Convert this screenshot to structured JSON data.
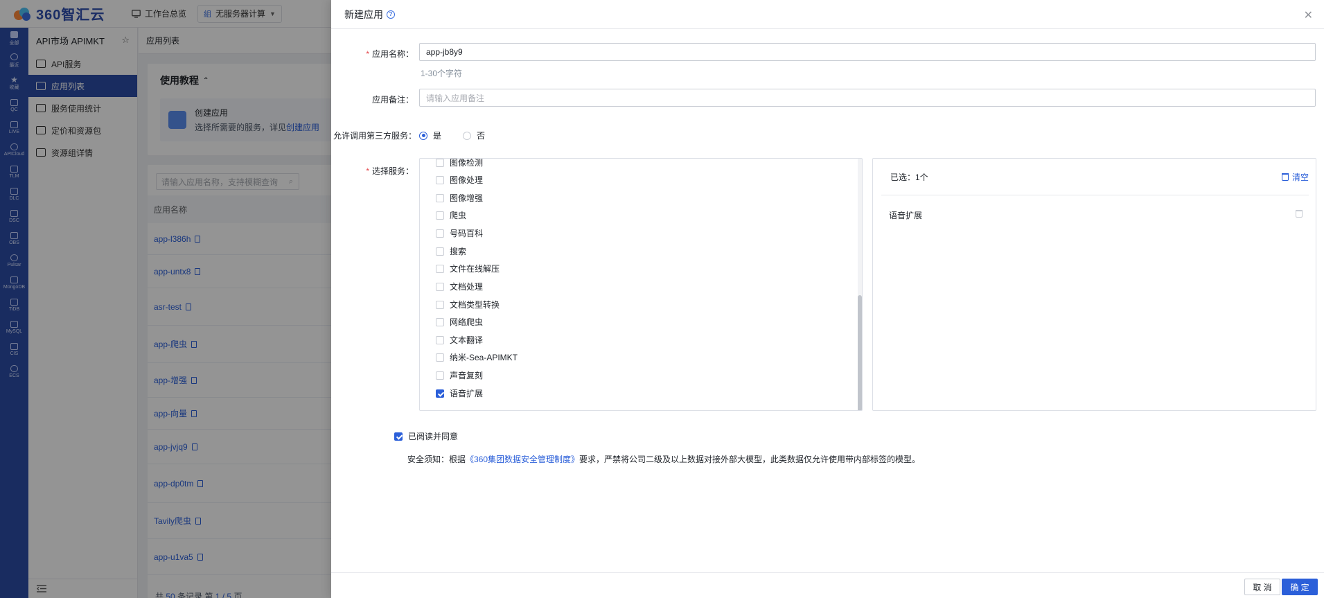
{
  "header": {
    "logo_text": "360智汇云",
    "workbench": "工作台总览",
    "project_select": "无服务器计算"
  },
  "rail": {
    "items": [
      {
        "label": "全部"
      },
      {
        "label": "最近"
      },
      {
        "label": "收藏"
      },
      {
        "label": "QC"
      },
      {
        "label": "LIVE"
      },
      {
        "label": "APICloud"
      },
      {
        "label": "TLM"
      },
      {
        "label": "DLC"
      },
      {
        "label": "DSC"
      },
      {
        "label": "OBS"
      },
      {
        "label": "Pulsar"
      },
      {
        "label": "MongoDB"
      },
      {
        "label": "TiDB"
      },
      {
        "label": "MySQL"
      },
      {
        "label": "CIS"
      },
      {
        "label": "ECS"
      }
    ]
  },
  "sidebar": {
    "title": "API市场 APIMKT",
    "items": [
      {
        "label": "API服务"
      },
      {
        "label": "应用列表"
      },
      {
        "label": "服务使用统计"
      },
      {
        "label": "定价和资源包"
      },
      {
        "label": "资源组详情"
      }
    ]
  },
  "main": {
    "breadcrumb": "应用列表",
    "tutorial_title": "使用教程",
    "tutorial_card_title": "创建应用",
    "tutorial_card_desc": "选择所需要的服务，详见",
    "tutorial_card_link": "创建应用",
    "search_placeholder": "请输入应用名称，支持模糊查询",
    "column_app_name": "应用名称",
    "rows": [
      "app-l386h",
      "app-untx8",
      "asr-test",
      "app-爬虫",
      "app-增强",
      "app-向量",
      "app-jvjq9",
      "app-dp0tm",
      "Tavily爬虫",
      "app-u1va5"
    ],
    "footer_prefix": "共",
    "footer_total": "50",
    "footer_mid": "条记录 第",
    "footer_page": "1 / 5",
    "footer_suffix": "页"
  },
  "drawer": {
    "title": "新建应用",
    "app_name_label": "应用名称：",
    "app_name_value": "app-jb8y9",
    "app_name_hint": "1-30个字符",
    "remark_label": "应用备注：",
    "remark_placeholder": "请输入应用备注",
    "third_party_label": "允许调用第三方服务：",
    "radio_yes": "是",
    "radio_no": "否",
    "service_label": "选择服务：",
    "services": [
      {
        "label": "图像检测",
        "checked": false
      },
      {
        "label": "图像处理",
        "checked": false
      },
      {
        "label": "图像增强",
        "checked": false
      },
      {
        "label": "爬虫",
        "checked": false
      },
      {
        "label": "号码百科",
        "checked": false
      },
      {
        "label": "搜索",
        "checked": false
      },
      {
        "label": "文件在线解压",
        "checked": false
      },
      {
        "label": "文档处理",
        "checked": false
      },
      {
        "label": "文档类型转换",
        "checked": false
      },
      {
        "label": "网络爬虫",
        "checked": false
      },
      {
        "label": "文本翻译",
        "checked": false
      },
      {
        "label": "纳米-Sea-APIMKT",
        "checked": false
      },
      {
        "label": "声音复刻",
        "checked": false
      },
      {
        "label": "语音扩展",
        "checked": true
      }
    ],
    "selected_count": "已选：1个",
    "clear_label": "清空",
    "selected_items": [
      "语音扩展"
    ],
    "agree_label": "已阅读并同意",
    "notice_prefix": "安全须知：根据",
    "notice_link": "《360集团数据安全管理制度》",
    "notice_suffix": "要求，严禁将公司二级及以上数据对接外部大模型，此类数据仅允许使用带内部标签的模型。",
    "cancel_label": "取 消",
    "ok_label": "确 定"
  },
  "colors": {
    "primary": "#2b5fd9",
    "rail": "#2b4da6",
    "required": "#e5484d"
  }
}
